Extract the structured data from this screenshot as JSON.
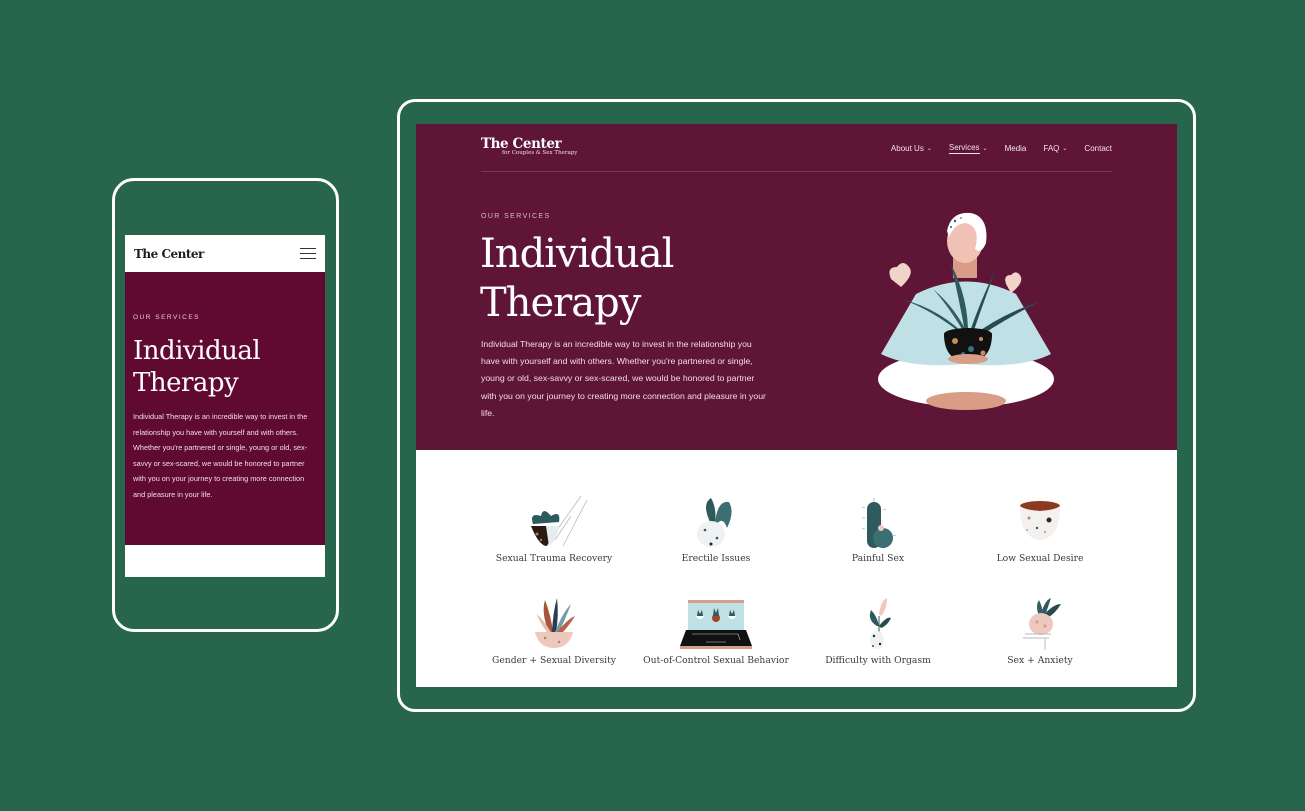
{
  "colors": {
    "background": "#27664d",
    "hero_desktop": "#5f1535",
    "hero_mobile": "#600a32",
    "teal": "#2f5a5d",
    "blush": "#e8b9aa",
    "light_blue": "#bfe1e6"
  },
  "mobile": {
    "logo": "The Center",
    "menu_icon": "hamburger-icon",
    "eyebrow": "OUR SERVICES",
    "title_line1": "Individual",
    "title_line2": "Therapy",
    "body": "Individual Therapy is an incredible way to invest in the relationship you have with yourself and with others. Whether you're partnered or single, young or old, sex-savvy or sex-scared, we would be honored to partner with you on your journey to creating more connection and pleasure in your life."
  },
  "desktop": {
    "logo": {
      "main": "The Center",
      "sub": "for Couples & Sex Therapy"
    },
    "nav": [
      {
        "label": "About Us",
        "has_dropdown": true,
        "active": false
      },
      {
        "label": "Services",
        "has_dropdown": true,
        "active": true
      },
      {
        "label": "Media",
        "has_dropdown": false,
        "active": false
      },
      {
        "label": "FAQ",
        "has_dropdown": true,
        "active": false
      },
      {
        "label": "Contact",
        "has_dropdown": false,
        "active": false
      }
    ],
    "eyebrow": "OUR SERVICES",
    "title_line1": "Individual",
    "title_line2": "Therapy",
    "body": "Individual Therapy is an incredible way to invest in the relationship you have with yourself and with others. Whether you're partnered or single, young or old, sex-savvy or sex-scared, we would be honored to partner with you on your journey to creating more connection and pleasure in your life.",
    "hero_illustration": "person-holding-plant-illustration",
    "services": [
      {
        "label": "Sexual Trauma Recovery",
        "icon": "broken-pot-plant-icon"
      },
      {
        "label": "Erectile Issues",
        "icon": "drooping-plant-icon"
      },
      {
        "label": "Painful Sex",
        "icon": "cactus-icon"
      },
      {
        "label": "Low Sexual Desire",
        "icon": "empty-pot-icon"
      },
      {
        "label": "Gender + Sexual Diversity",
        "icon": "multicolor-leaves-icon"
      },
      {
        "label": "Out-of-Control Sexual Behavior",
        "icon": "laptop-plants-icon"
      },
      {
        "label": "Difficulty with Orgasm",
        "icon": "flower-bud-icon"
      },
      {
        "label": "Sex + Anxiety",
        "icon": "pot-on-ledge-icon"
      }
    ]
  }
}
